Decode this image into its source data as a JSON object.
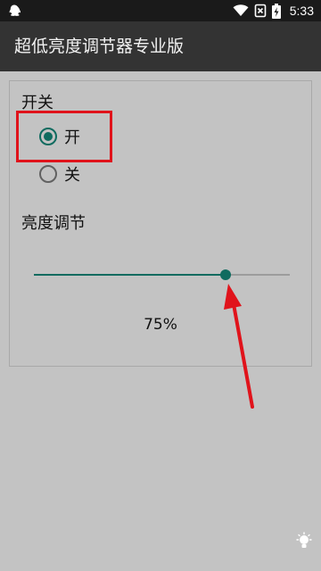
{
  "status_bar": {
    "time": "5:33",
    "icons": [
      "qq-icon",
      "wifi-icon",
      "no-sim-icon",
      "battery-charging-icon"
    ]
  },
  "app_bar": {
    "title": "超低亮度调节器专业版"
  },
  "switch_section": {
    "label": "开关",
    "options": [
      {
        "label": "开",
        "checked": true
      },
      {
        "label": "关",
        "checked": false
      }
    ]
  },
  "brightness_section": {
    "label": "亮度调节",
    "value_fraction": 0.75,
    "value_text": "75%"
  },
  "floating_icon": "lightbulb-icon",
  "colors": {
    "accent": "#0f6b5f",
    "annotation": "#e0131b",
    "background": "#c3c3c3",
    "app_bar": "#333333",
    "status_bar": "#1a1a1a"
  }
}
